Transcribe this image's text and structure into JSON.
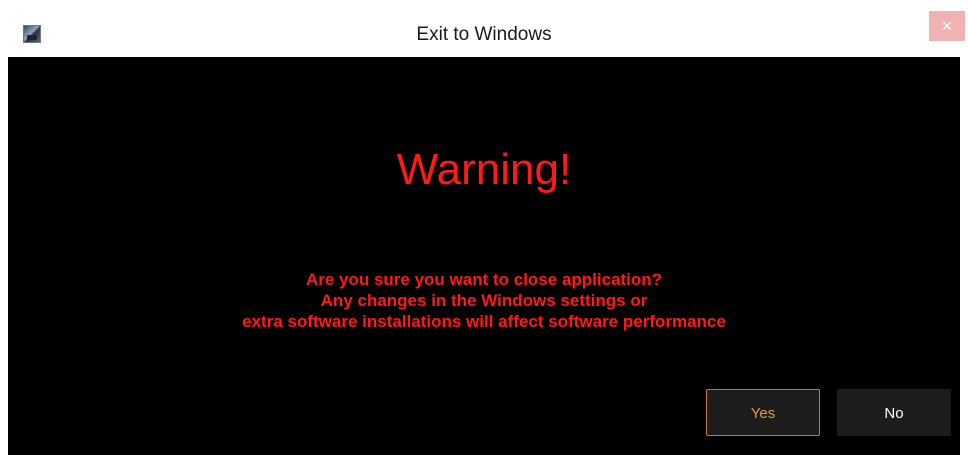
{
  "window": {
    "title": "Exit to Windows",
    "close_label": "✕"
  },
  "dialog": {
    "heading": "Warning!",
    "message_lines": [
      "Are you sure you want to close application?",
      "Any changes in the Windows settings or",
      "extra software installations will affect software performance"
    ],
    "yes_label": "Yes",
    "no_label": "No"
  },
  "colors": {
    "warning_text": "#ff1a1a",
    "background": "#000000",
    "yes_accent": "#e89a3a",
    "close_button": "#f0b3b3"
  },
  "icons": {
    "app": "app-icon",
    "close": "close-icon"
  }
}
